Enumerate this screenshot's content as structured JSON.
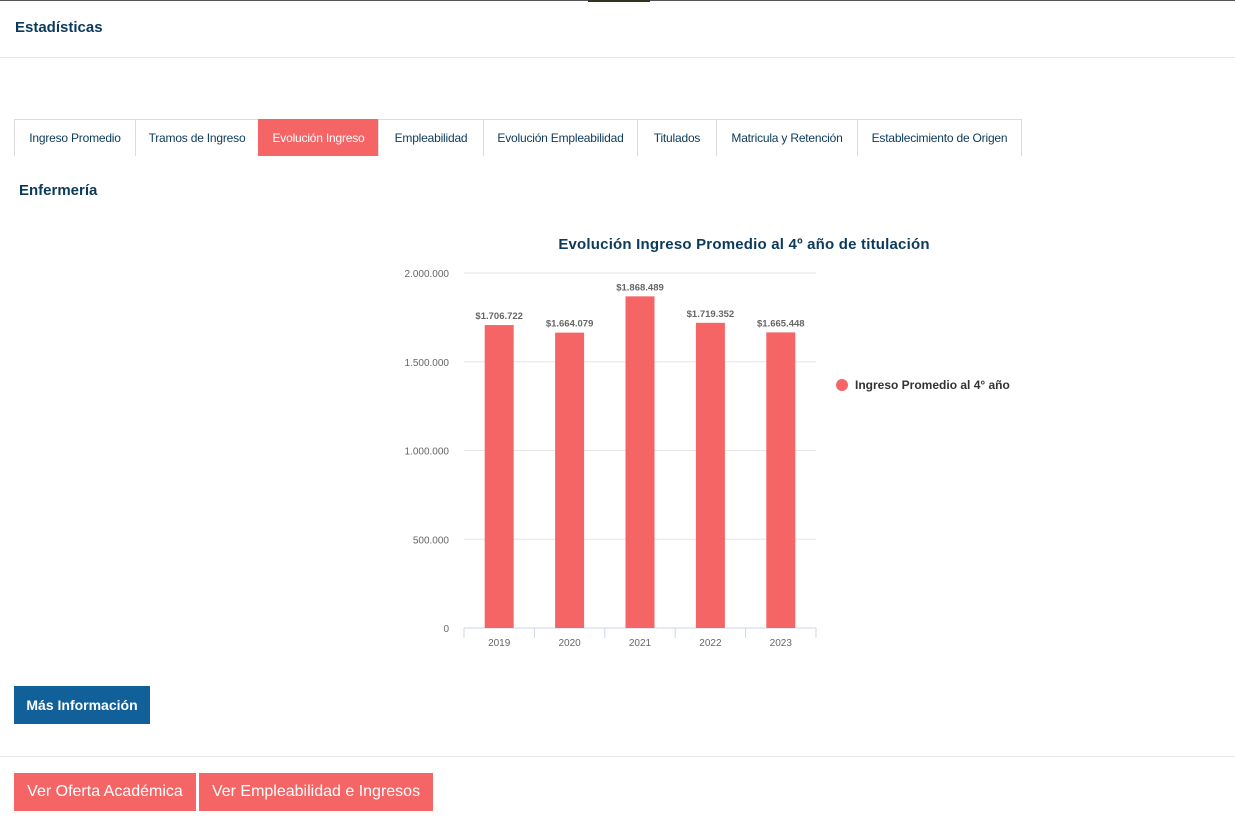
{
  "page": {
    "section_title": "Estadísticas",
    "career_title": "Enfermería"
  },
  "tabs": [
    {
      "label": "Ingreso Promedio",
      "active": false
    },
    {
      "label": "Tramos de Ingreso",
      "active": false
    },
    {
      "label": "Evolución Ingreso",
      "active": true
    },
    {
      "label": "Empleabilidad",
      "active": false
    },
    {
      "label": "Evolución Empleabilidad",
      "active": false
    },
    {
      "label": "Titulados",
      "active": false
    },
    {
      "label": "Matricula y Retención",
      "active": false
    },
    {
      "label": "Establecimiento de Origen",
      "active": false
    }
  ],
  "chart_data": {
    "type": "bar",
    "title": "Evolución Ingreso Promedio al 4º año de titulación",
    "categories": [
      "2019",
      "2020",
      "2021",
      "2022",
      "2023"
    ],
    "series": [
      {
        "name": "Ingreso Promedio al 4° año",
        "values": [
          1706722,
          1664079,
          1868489,
          1719352,
          1665448
        ],
        "data_labels": [
          "$1.706.722",
          "$1.664.079",
          "$1.868.489",
          "$1.719.352",
          "$1.665.448"
        ]
      }
    ],
    "ylim": [
      0,
      2000000
    ],
    "y_ticks": [
      0,
      500000,
      1000000,
      1500000,
      2000000
    ],
    "y_tick_labels": [
      "0",
      "500.000",
      "1.000.000",
      "1.500.000",
      "2.000.000"
    ],
    "grid": true,
    "legend_position": "right",
    "bar_color": "#f56566"
  },
  "buttons": {
    "more_info": "Más Información",
    "academic_offer": "Ver Oferta Académica",
    "employability": "Ver Empleabilidad e Ingresos"
  },
  "colors": {
    "accent": "#f56566",
    "primary": "#11609a",
    "heading": "#0b3a5a"
  }
}
